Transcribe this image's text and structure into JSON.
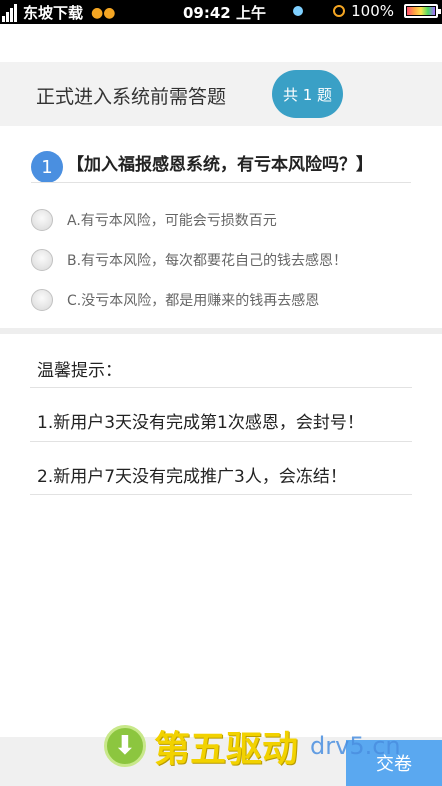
{
  "status_bar": {
    "carrier": "东坡下载",
    "time": "09:42 上午",
    "battery": "100%"
  },
  "header": {
    "title": "正式进入系统前需答题",
    "count_badge": "共 1 题"
  },
  "question": {
    "number": "1",
    "text": "【加入福报感恩系统，有亏本风险吗？】",
    "options": [
      {
        "label": "A.有亏本风险，可能会亏损数百元",
        "selected": false
      },
      {
        "label": "B.有亏本风险，每次都要花自己的钱去感恩！",
        "selected": false
      },
      {
        "label": "C.没亏本风险，都是用赚来的钱再去感恩",
        "selected": false
      }
    ]
  },
  "tips": {
    "title": "温馨提示：",
    "items": [
      "1.新用户3天没有完成第1次感恩，会封号！",
      "2.新用户7天没有完成推广3人，会冻结！"
    ]
  },
  "footer": {
    "submit_label": "交卷"
  },
  "watermark": {
    "text": "第五驱动",
    "url": "drv5.cn"
  },
  "colors": {
    "accent_blue": "#4a8fe0",
    "badge_teal": "#3aa0c6",
    "submit_blue": "#5aa8f0"
  }
}
